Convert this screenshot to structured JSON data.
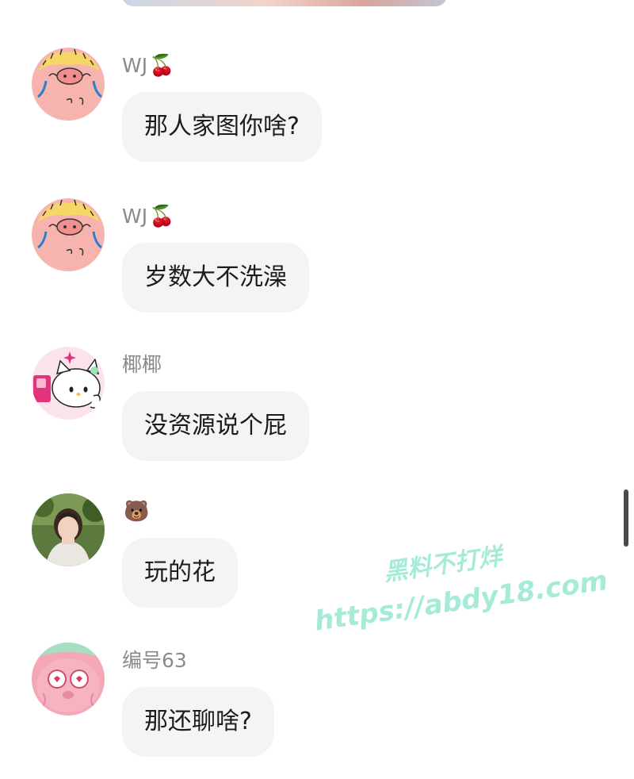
{
  "messages": [
    {
      "sender": "WJ",
      "badge": "🍒",
      "text": "那人家图你啥?",
      "avatar": "crying-pig-avatar"
    },
    {
      "sender": "WJ",
      "badge": "🍒",
      "text": "岁数大不洗澡",
      "avatar": "crying-pig-avatar"
    },
    {
      "sender": "椰椰",
      "badge": "",
      "text": "没资源说个屁",
      "avatar": "hello-kitty-avatar"
    },
    {
      "sender": "",
      "badge": "🐻",
      "text": "玩的花",
      "avatar": "photo-avatar"
    },
    {
      "sender": "编号63",
      "badge": "",
      "text": "那还聊啥?",
      "avatar": "pink-blob-avatar"
    }
  ],
  "watermark": {
    "line1": "黑料不打烊",
    "line2": "https://abdy18.com"
  },
  "colors": {
    "bubble": "#f4f4f4",
    "sender": "#8a8a8a",
    "watermark": "#a6ead8"
  }
}
